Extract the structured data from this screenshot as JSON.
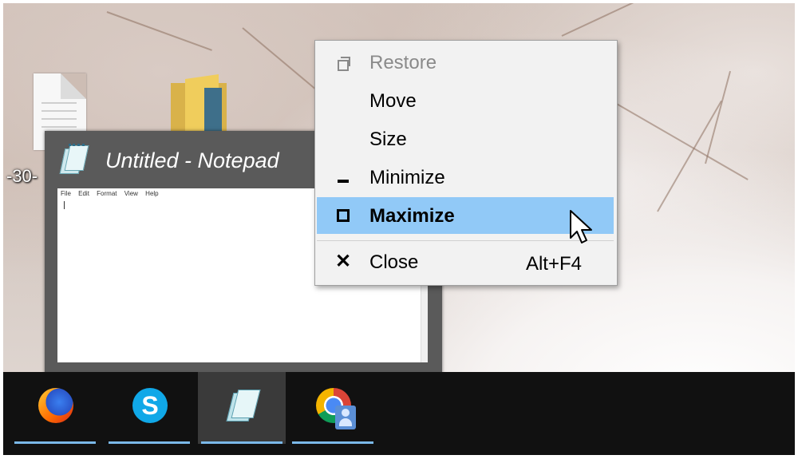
{
  "desktop": {
    "partial_label": "-30-"
  },
  "preview_window": {
    "title": "Untitled - Notepad",
    "menu": [
      "File",
      "Edit",
      "Format",
      "View",
      "Help"
    ]
  },
  "context_menu": {
    "items": [
      {
        "label": "Restore",
        "icon": "restore-icon",
        "enabled": false
      },
      {
        "label": "Move",
        "icon": "",
        "enabled": true
      },
      {
        "label": "Size",
        "icon": "",
        "enabled": true
      },
      {
        "label": "Minimize",
        "icon": "minimize-icon",
        "enabled": true
      },
      {
        "label": "Maximize",
        "icon": "maximize-icon",
        "enabled": true,
        "highlighted": true
      },
      {
        "label": "Close",
        "icon": "close-icon",
        "enabled": true,
        "shortcut": "Alt+F4"
      }
    ],
    "highlight_color": "#91c9f7"
  },
  "taskbar": {
    "apps": [
      {
        "name": "firefox-icon",
        "active": false,
        "running": true
      },
      {
        "name": "skype-icon",
        "glyph": "S",
        "active": false,
        "running": true
      },
      {
        "name": "notepad-icon",
        "active": true,
        "running": true
      },
      {
        "name": "chrome-icon",
        "active": false,
        "running": true
      }
    ],
    "accent_color": "#7ab8e8"
  }
}
